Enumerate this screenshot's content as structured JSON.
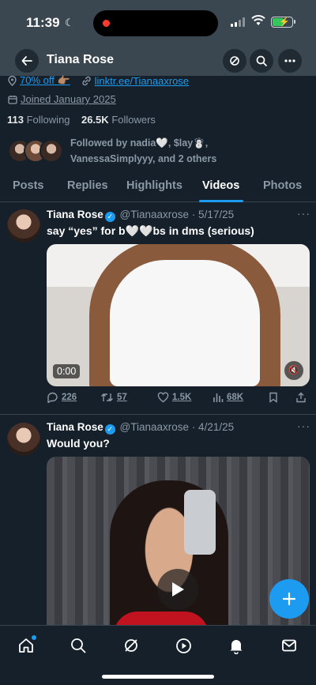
{
  "status_bar": {
    "time": "11:39"
  },
  "nav": {
    "title": "Tiana Rose"
  },
  "profile": {
    "promo_text": "70% off 👉🏽",
    "link_text": "linktr.ee/Tianaaxrose",
    "joined": "Joined January 2025",
    "following_count": "113",
    "following_label": "Following",
    "followers_count": "26.5K",
    "followers_label": "Followers",
    "followed_by": "Followed by nadia🤍, $lay☃️, VanessaSimplyyy, and 2 others"
  },
  "tabs": [
    "Posts",
    "Replies",
    "Highlights",
    "Videos",
    "Photos"
  ],
  "active_tab": "Videos",
  "tweets": [
    {
      "name": "Tiana Rose",
      "handle": "@Tianaaxrose",
      "date": "· 5/17/25",
      "text": "say “yes” for b🤍🤍bs in dms (serious)",
      "video_time": "0:00",
      "replies": "226",
      "reposts": "57",
      "likes": "1.5K",
      "views": "68K"
    },
    {
      "name": "Tiana Rose",
      "handle": "@Tianaaxrose",
      "date": "· 4/21/25",
      "text": "Would you?"
    }
  ],
  "colors": {
    "accent": "#1d9bf0",
    "background": "#15202b",
    "header": "#3a4650",
    "muted": "#8b98a5"
  }
}
